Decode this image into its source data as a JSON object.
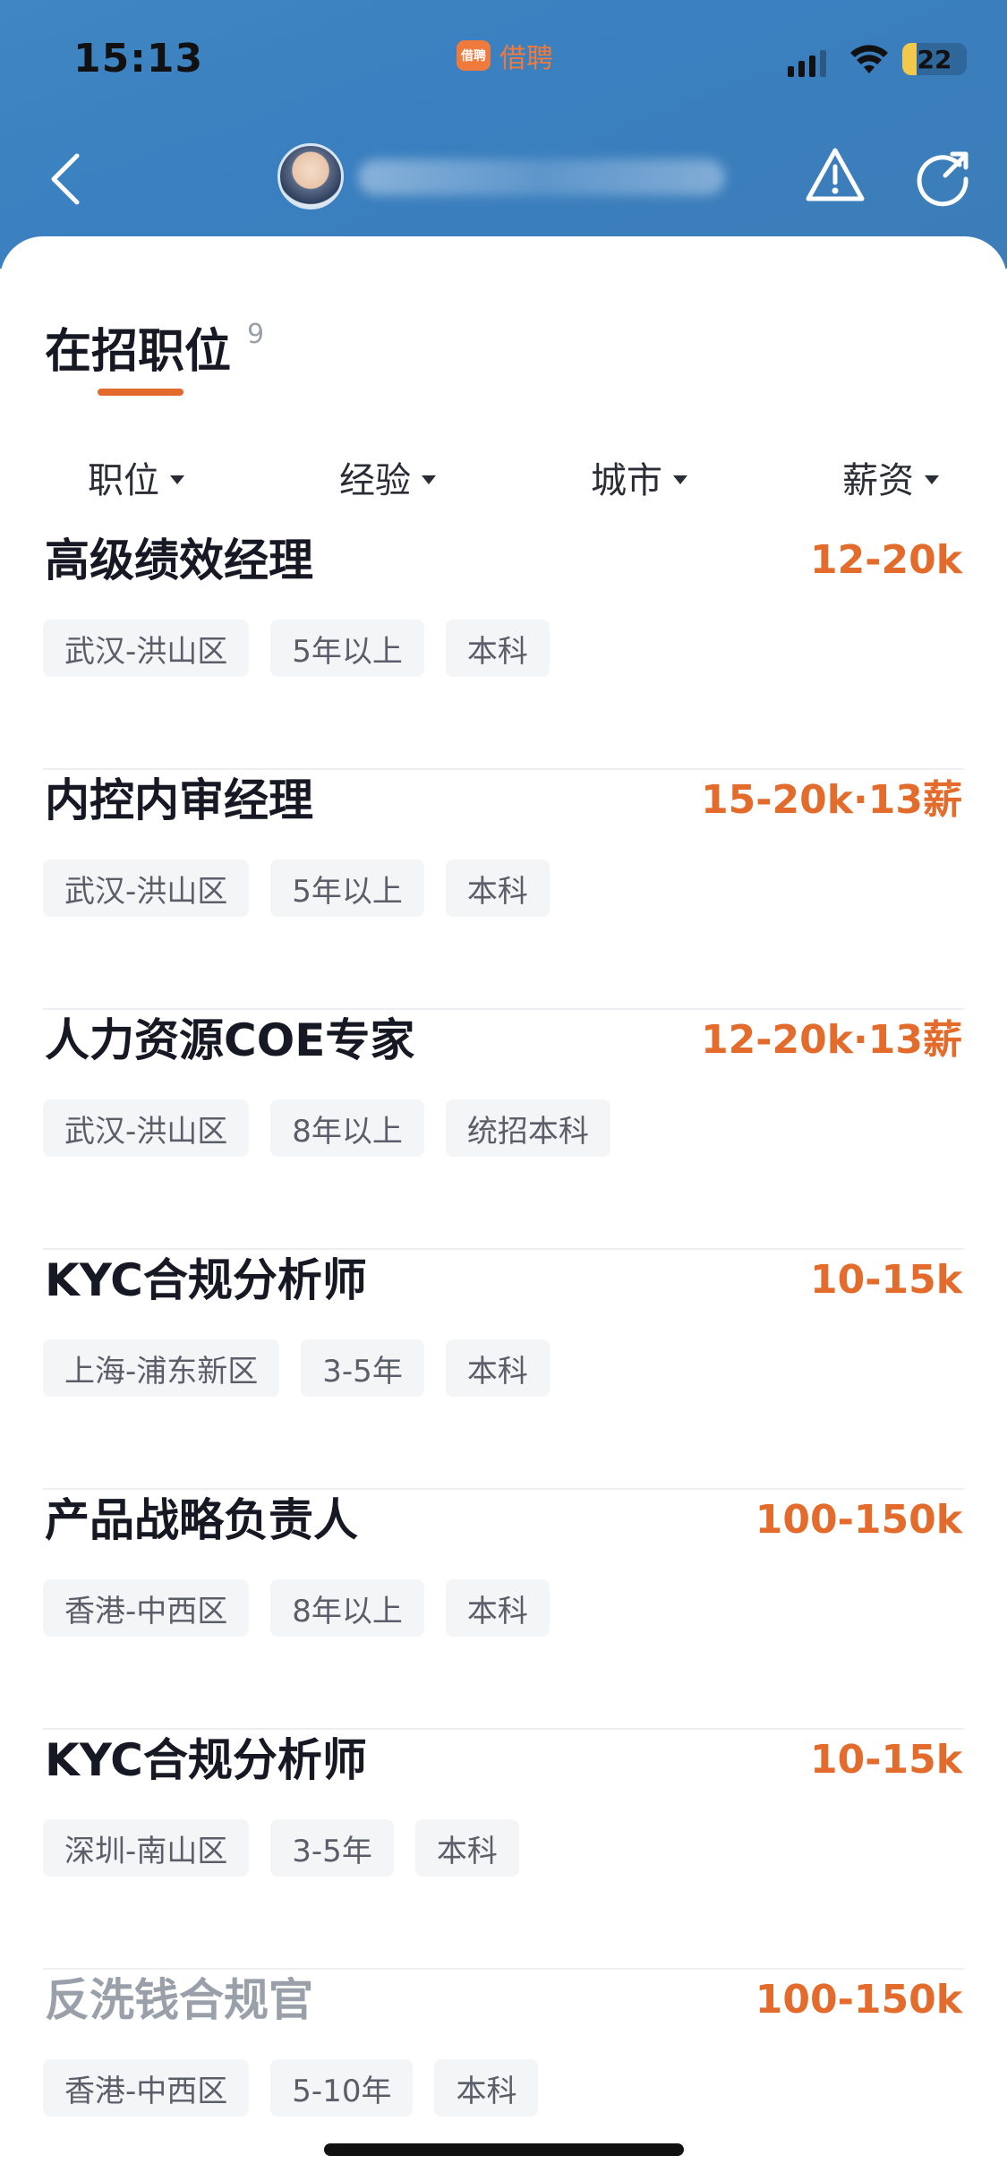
{
  "status_bar": {
    "time": "15:13",
    "app_badge_text": "借聘",
    "app_name": "借聘",
    "battery_level": "22",
    "battery_fill_fraction": 0.22,
    "battery_color": "#f2c94c"
  },
  "nav": {
    "back_icon": "chevron-left-icon",
    "report_icon": "warning-triangle-icon",
    "share_icon": "share-icon",
    "header_color": "#3a7fbf"
  },
  "section": {
    "title": "在招职位",
    "count": "9",
    "accent_color": "#e26a2c"
  },
  "filters": [
    {
      "label": "职位"
    },
    {
      "label": "经验"
    },
    {
      "label": "城市"
    },
    {
      "label": "薪资"
    }
  ],
  "jobs": [
    {
      "title": "高级绩效经理",
      "salary": "12-20k",
      "tags": [
        "武汉-洪山区",
        "5年以上",
        "本科"
      ]
    },
    {
      "title": "内控内审经理",
      "salary": "15-20k·13薪",
      "tags": [
        "武汉-洪山区",
        "5年以上",
        "本科"
      ]
    },
    {
      "title": "人力资源COE专家",
      "salary": "12-20k·13薪",
      "tags": [
        "武汉-洪山区",
        "8年以上",
        "统招本科"
      ]
    },
    {
      "title": "KYC合规分析师",
      "salary": "10-15k",
      "tags": [
        "上海-浦东新区",
        "3-5年",
        "本科"
      ]
    },
    {
      "title": "产品战略负责人",
      "salary": "100-150k",
      "tags": [
        "香港-中西区",
        "8年以上",
        "本科"
      ]
    },
    {
      "title": "KYC合规分析师",
      "salary": "10-15k",
      "tags": [
        "深圳-南山区",
        "3-5年",
        "本科"
      ]
    },
    {
      "title": "反洗钱合规官",
      "salary": "100-150k",
      "tags": [
        "香港-中西区",
        "5-10年",
        "本科"
      ],
      "dimmed": true
    }
  ],
  "salary_color": "#e36b2c"
}
